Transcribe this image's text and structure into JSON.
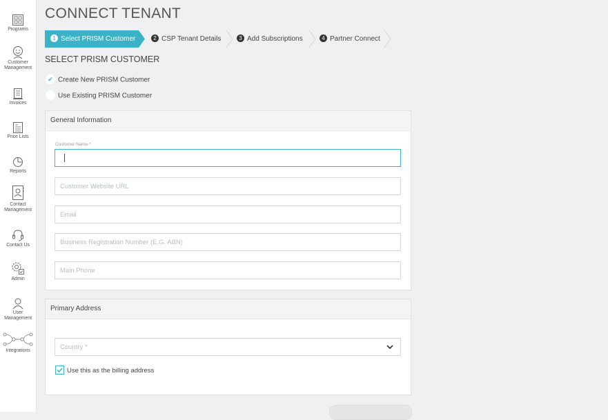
{
  "sidebar": {
    "items": [
      {
        "label_lines": [
          "Programs"
        ],
        "icon": "programs-icon"
      },
      {
        "label_lines": [
          "Customer",
          "Management"
        ],
        "icon": "customer-management-icon"
      },
      {
        "label_lines": [
          "Invoices"
        ],
        "icon": "invoices-icon"
      },
      {
        "label_lines": [
          "Price Lists"
        ],
        "icon": "price-lists-icon"
      },
      {
        "label_lines": [
          "Reports"
        ],
        "icon": "reports-icon"
      },
      {
        "label_lines": [
          "Contact",
          "Management"
        ],
        "icon": "contact-management-icon"
      },
      {
        "label_lines": [
          "Contact Us"
        ],
        "icon": "contact-us-icon"
      },
      {
        "label_lines": [
          "Admin"
        ],
        "icon": "admin-icon"
      },
      {
        "label_lines": [
          "User",
          "Management"
        ],
        "icon": "user-management-icon"
      },
      {
        "label_lines": [
          "Integrations"
        ],
        "icon": "integrations-icon"
      }
    ]
  },
  "page": {
    "title": "CONNECT TENANT",
    "section_title": "SELECT PRISM CUSTOMER"
  },
  "steps": [
    {
      "number": "1",
      "label": "Select PRISM Customer",
      "active": true
    },
    {
      "number": "2",
      "label": "CSP Tenant Details",
      "active": false
    },
    {
      "number": "3",
      "label": "Add Subscriptions",
      "active": false
    },
    {
      "number": "4",
      "label": "Partner Connect",
      "active": false
    }
  ],
  "customer_choice": {
    "options": [
      {
        "label": "Create New PRISM Customer",
        "selected": true
      },
      {
        "label": "Use Existing PRISM Customer",
        "selected": false
      }
    ]
  },
  "general_info": {
    "header": "General Information",
    "customer_name_label": "Customer Name *",
    "customer_name_value": "",
    "website_placeholder": "Customer Website URL",
    "email_placeholder": "Email",
    "abn_placeholder": "Business Registration Number (E.G. ABN)",
    "phone_placeholder": "Main Phone"
  },
  "primary_address": {
    "header": "Primary Address",
    "country_placeholder": "Country *",
    "billing_checkbox_label": "Use this as the billing address",
    "billing_checked": true
  },
  "colors": {
    "accent": "#3ab3c7",
    "background": "#eef0f1"
  }
}
